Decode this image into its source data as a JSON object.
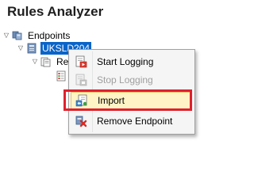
{
  "panel": {
    "title": "Rules Analyzer"
  },
  "tree": {
    "root": {
      "label": "Endpoints",
      "icon": "endpoints-icon",
      "expanded": true
    },
    "child": {
      "label": "UKSLD204",
      "icon": "server-icon",
      "expanded": true,
      "selected": true
    },
    "grandchild": {
      "label": "Re",
      "icon": "rules-icon",
      "expanded": true
    },
    "leaf": {
      "label": "",
      "icon": "rule-file-icon"
    }
  },
  "context_menu": {
    "items": [
      {
        "label": "Start Logging",
        "icon": "start-logging-icon",
        "enabled": true
      },
      {
        "label": "Stop Logging",
        "icon": "stop-logging-icon",
        "enabled": false
      },
      {
        "label": "Import",
        "icon": "import-icon",
        "enabled": true,
        "highlighted": true
      },
      {
        "label": "Remove Endpoint",
        "icon": "remove-endpoint-icon",
        "enabled": true
      }
    ]
  },
  "colors": {
    "selection": "#0a64c8",
    "highlight_box": "#e0202c",
    "hover_fill": "#fff4c6"
  }
}
